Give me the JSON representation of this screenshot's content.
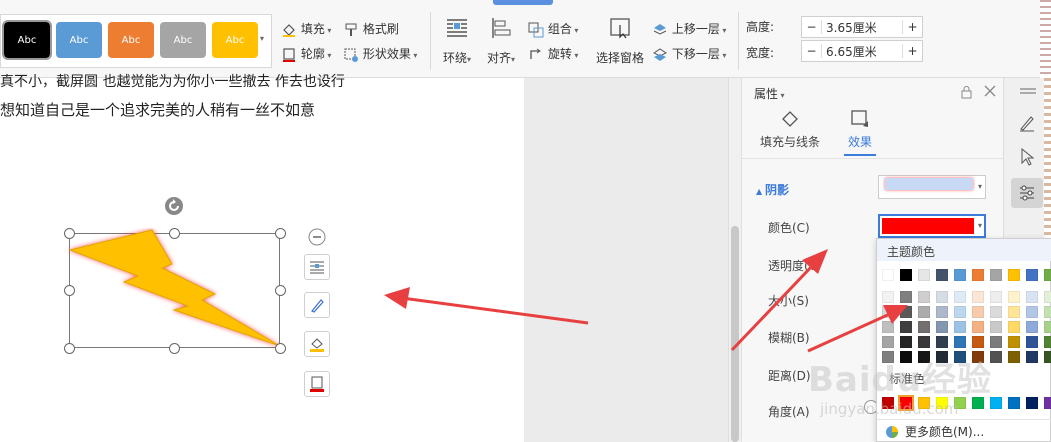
{
  "ribbon": {
    "styles": [
      {
        "label": "Abc",
        "bg": "#000000",
        "fg": "#ffffff"
      },
      {
        "label": "Abc",
        "bg": "#5b9bd5",
        "fg": "#ffffff"
      },
      {
        "label": "Abc",
        "bg": "#ed7d31",
        "fg": "#ffffff"
      },
      {
        "label": "Abc",
        "bg": "#a5a5a5",
        "fg": "#ffffff"
      },
      {
        "label": "Abc",
        "bg": "#ffc000",
        "fg": "#ffffff"
      }
    ],
    "fill": "填充",
    "outline": "轮廓",
    "format_painter": "格式刷",
    "shape_effect": "形状效果",
    "wrap": "环绕",
    "align": "对齐",
    "group": "组合",
    "rotate": "旋转",
    "selection_pane": "选择窗格",
    "bring_forward": "上移一层",
    "send_backward": "下移一层",
    "height_label": "高度:",
    "height_value": "3.65厘米",
    "width_label": "宽度:",
    "width_value": "6.65厘米",
    "minus": "−",
    "plus": "+"
  },
  "document": {
    "line1": "真不小，截屏圆 也越觉能为为你小一些撤去 作去也设行",
    "line2": "想知道自己是一个追求完美的人稍有一丝不如意"
  },
  "panel": {
    "title": "属性",
    "tab_fill": "填充与线条",
    "tab_effect": "效果",
    "section_shadow": "阴影",
    "color_label": "颜色(C)",
    "transparency_label": "透明度(T)",
    "size_label": "大小(S)",
    "blur_label": "模糊(B)",
    "distance_label": "距离(D)",
    "angle_label": "角度(A)",
    "selected_color": "#ff0000"
  },
  "popup": {
    "theme_title": "主题颜色",
    "standard_title": "标准色",
    "more_colors": "更多颜色(M)...",
    "theme_top": [
      "#ffffff",
      "#000000",
      "#e7e6e6",
      "#44546a",
      "#5b9bd5",
      "#ed7d31",
      "#a5a5a5",
      "#ffc000",
      "#4472c4",
      "#70ad47"
    ],
    "shade_rows": [
      [
        "#f2f2f2",
        "#7f7f7f",
        "#d0cece",
        "#d6dce4",
        "#deebf6",
        "#fbe5d5",
        "#ededed",
        "#fff2cc",
        "#dae3f3",
        "#e2efd9"
      ],
      [
        "#d8d8d8",
        "#595959",
        "#aeabab",
        "#adb9ca",
        "#bdd7ee",
        "#f7cbac",
        "#dbdbdb",
        "#ffe598",
        "#b4c6e7",
        "#c5e0b3"
      ],
      [
        "#bfbfbf",
        "#3f3f3f",
        "#757070",
        "#8496b0",
        "#9cc3e5",
        "#f4b183",
        "#c9c9c9",
        "#ffd965",
        "#8eaadb",
        "#a8d08d"
      ],
      [
        "#a5a5a5",
        "#262626",
        "#3a3838",
        "#323f4f",
        "#2e75b5",
        "#c55a11",
        "#7b7b7b",
        "#bf9000",
        "#2f5496",
        "#538135"
      ],
      [
        "#7f7f7f",
        "#0c0c0c",
        "#171616",
        "#222a35",
        "#1e4e79",
        "#833c0b",
        "#525252",
        "#7f6000",
        "#1f3864",
        "#375623"
      ]
    ],
    "standard": [
      "#c00000",
      "#ff0000",
      "#ffc000",
      "#ffff00",
      "#92d050",
      "#00b050",
      "#00b0f0",
      "#0070c0",
      "#002060",
      "#7030a0"
    ]
  },
  "watermark": {
    "text": "Baidu经验",
    "sub": "jingyan.baidu.com"
  },
  "colors": {
    "accent": "#3c7bd9",
    "arrow": "#e84040",
    "bolt": "#ffc000"
  }
}
